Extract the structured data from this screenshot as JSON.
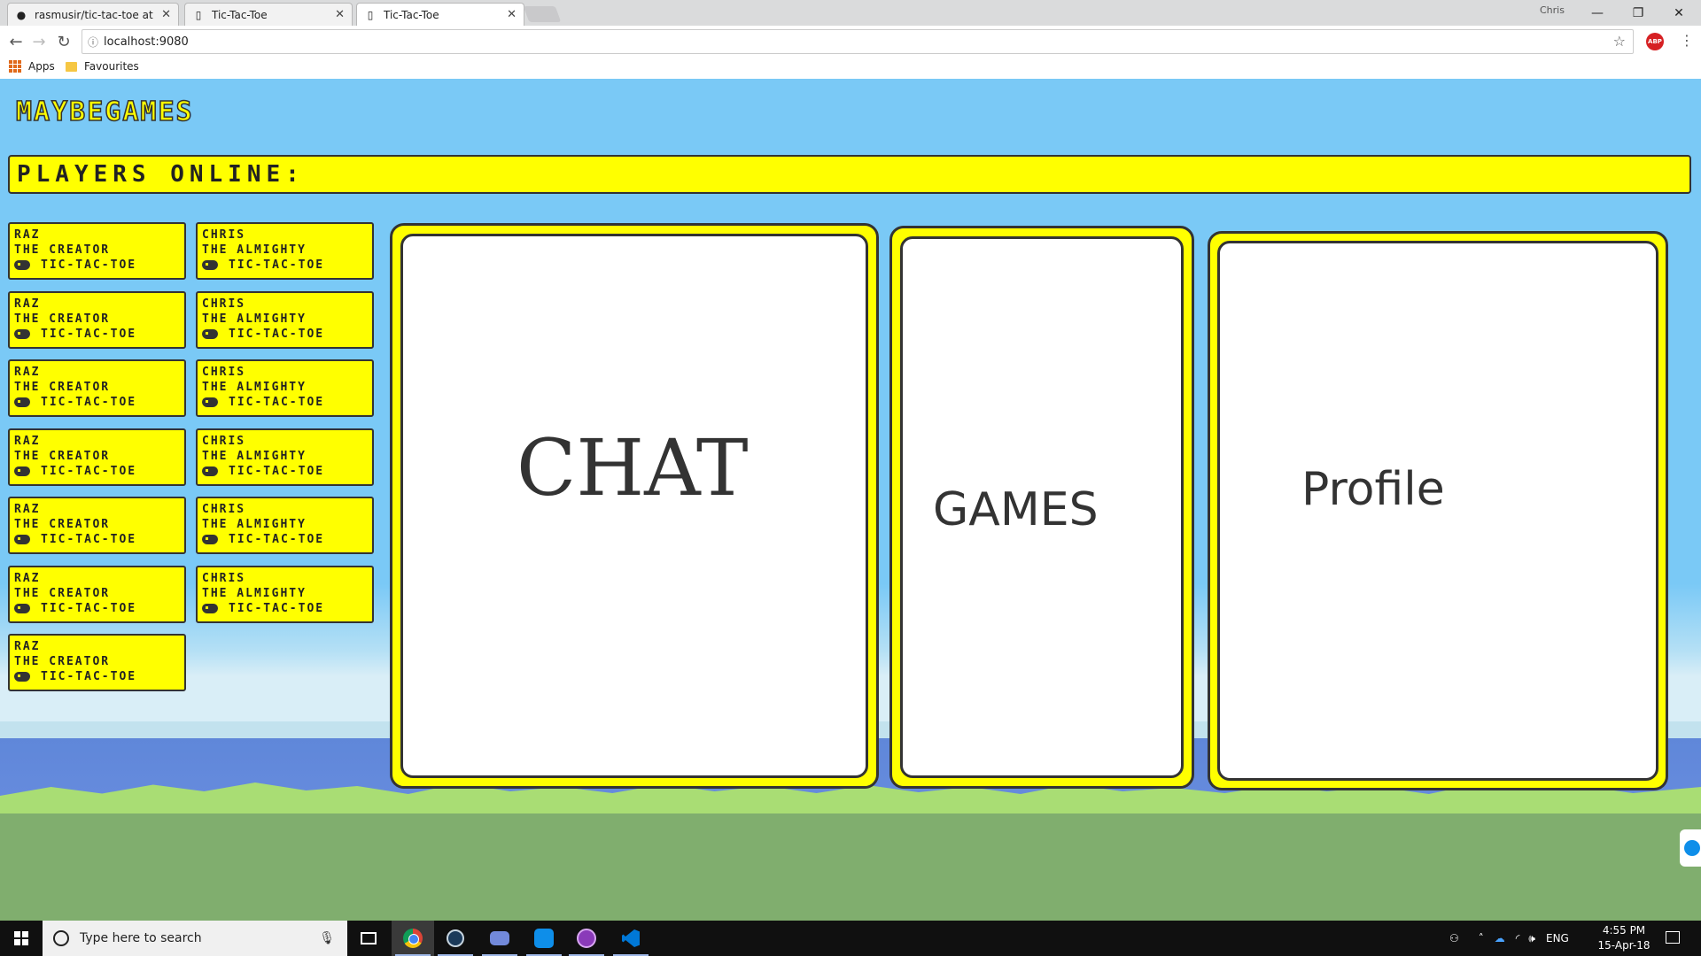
{
  "browser": {
    "tabs": [
      {
        "title": "rasmusir/tic-tac-toe at G",
        "icon": "github-icon",
        "active": false
      },
      {
        "title": "Tic-Tac-Toe",
        "icon": "page-icon",
        "active": false
      },
      {
        "title": "Tic-Tac-Toe",
        "icon": "page-icon",
        "active": true
      }
    ],
    "user": "Chris",
    "address": "localhost:9080",
    "bookmarks": {
      "apps": "Apps",
      "favourites": "Favourites"
    },
    "abp_label": "ABP"
  },
  "page": {
    "logo": "MAYBEGAMES",
    "players_online_label": "PLAYERS ONLINE:",
    "players": [
      {
        "name": "RAZ",
        "title": "THE CREATOR",
        "game": "TIC-TAC-TOE"
      },
      {
        "name": "CHRIS",
        "title": "THE ALMIGHTY",
        "game": "TIC-TAC-TOE"
      },
      {
        "name": "RAZ",
        "title": "THE CREATOR",
        "game": "TIC-TAC-TOE"
      },
      {
        "name": "CHRIS",
        "title": "THE ALMIGHTY",
        "game": "TIC-TAC-TOE"
      },
      {
        "name": "RAZ",
        "title": "THE CREATOR",
        "game": "TIC-TAC-TOE"
      },
      {
        "name": "CHRIS",
        "title": "THE ALMIGHTY",
        "game": "TIC-TAC-TOE"
      },
      {
        "name": "RAZ",
        "title": "THE CREATOR",
        "game": "TIC-TAC-TOE"
      },
      {
        "name": "CHRIS",
        "title": "THE ALMIGHTY",
        "game": "TIC-TAC-TOE"
      },
      {
        "name": "RAZ",
        "title": "THE CREATOR",
        "game": "TIC-TAC-TOE"
      },
      {
        "name": "CHRIS",
        "title": "THE ALMIGHTY",
        "game": "TIC-TAC-TOE"
      },
      {
        "name": "RAZ",
        "title": "THE CREATOR",
        "game": "TIC-TAC-TOE"
      },
      {
        "name": "CHRIS",
        "title": "THE ALMIGHTY",
        "game": "TIC-TAC-TOE"
      },
      {
        "name": "RAZ",
        "title": "THE CREATOR",
        "game": "TIC-TAC-TOE"
      }
    ],
    "panels": {
      "chat": "CHAT",
      "games": "GAMES",
      "profile": "Profile"
    }
  },
  "taskbar": {
    "search_placeholder": "Type here to search",
    "language": "ENG",
    "time": "4:55 PM",
    "date": "15-Apr-18"
  },
  "colors": {
    "accent_yellow": "#ffff00",
    "sky": "#7ac9f6",
    "grass": "#80ae6e",
    "border": "#333333"
  }
}
